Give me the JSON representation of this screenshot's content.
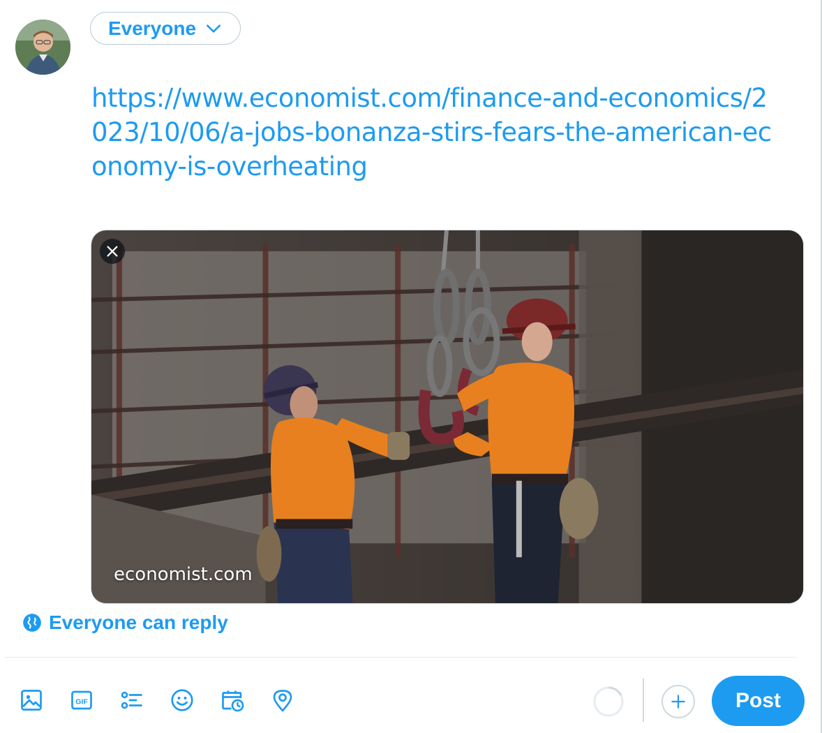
{
  "composer": {
    "audience_label": "Everyone",
    "tweet_text": "https://www.economist.com/finance-and-economics/2023/10/06/a-jobs-bonanza-stirs-fears-the-american-economy-is-overheating",
    "card": {
      "domain": "economist.com"
    },
    "reply_setting": "Everyone can reply",
    "post_label": "Post"
  },
  "colors": {
    "accent": "#1d9bf0",
    "border": "#cfd9de"
  },
  "icons": {
    "audience": "chevron-down-icon",
    "card_remove": "close-icon",
    "reply": "globe-icon",
    "toolbar": [
      "image-icon",
      "gif-icon",
      "poll-icon",
      "emoji-icon",
      "schedule-icon",
      "location-icon"
    ],
    "add": "plus-icon"
  }
}
